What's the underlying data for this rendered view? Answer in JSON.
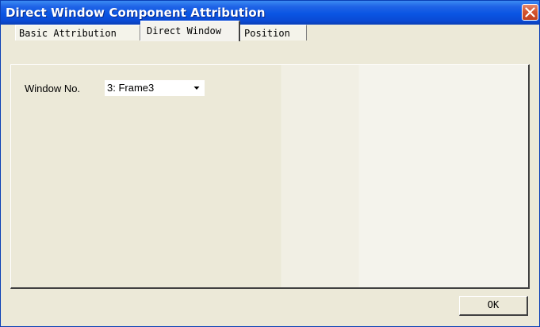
{
  "window": {
    "title": "Direct Window Component Attribution"
  },
  "tabs": [
    {
      "label": "Basic Attribution",
      "selected": false
    },
    {
      "label": "Direct Window",
      "selected": true
    },
    {
      "label": "Position",
      "selected": false
    }
  ],
  "form": {
    "window_no_label": "Window No.",
    "window_no_value": "3: Frame3"
  },
  "footer": {
    "ok_label": "OK"
  },
  "icons": {
    "close": "close-icon",
    "dropdown": "chevron-down-icon"
  },
  "colors": {
    "titlebar": "#0a55e3",
    "dialog_background": "#ece9d8",
    "close_button": "#d4552f"
  }
}
